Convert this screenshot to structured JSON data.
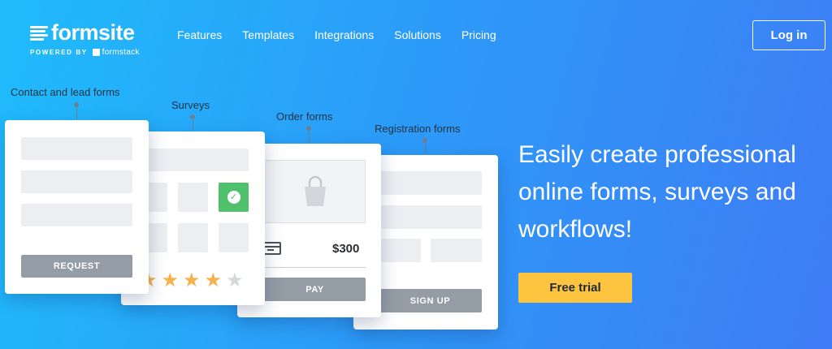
{
  "logo": {
    "wordmark": "formsite",
    "powered_by": "POWERED BY",
    "partner": "formstack"
  },
  "nav": {
    "items": [
      {
        "label": "Features"
      },
      {
        "label": "Templates"
      },
      {
        "label": "Integrations"
      },
      {
        "label": "Solutions"
      },
      {
        "label": "Pricing"
      }
    ]
  },
  "header": {
    "login_label": "Log in"
  },
  "forms": {
    "contact": {
      "label": "Contact and lead forms",
      "button": "REQUEST"
    },
    "surveys": {
      "label": "Surveys",
      "rating": 4,
      "rating_max": 5
    },
    "order": {
      "label": "Order forms",
      "price": "$300",
      "button": "PAY"
    },
    "registration": {
      "label": "Registration forms",
      "button": "SIGN UP"
    }
  },
  "hero": {
    "headline": "Easily create professional online forms, surveys and workflows!",
    "cta_label": "Free trial"
  },
  "colors": {
    "accent": "#fdc43f",
    "bg_start": "#1fbcfb",
    "bg_end": "#3f7cf5",
    "check": "#4fc16c",
    "star": "#f5b14b"
  },
  "icons": [
    "logo-stripes-icon",
    "formstack-icon",
    "check-icon",
    "star-icon",
    "shopping-bag-icon",
    "credit-card-icon"
  ]
}
